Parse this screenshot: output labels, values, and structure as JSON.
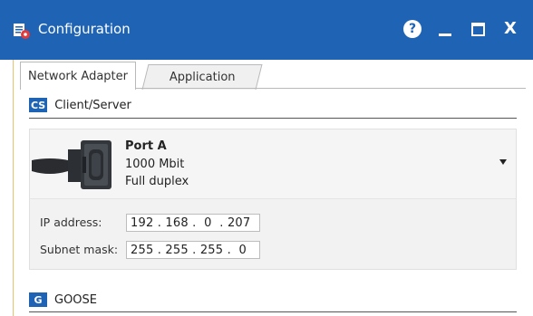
{
  "window": {
    "title": "Configuration",
    "controls": {
      "help": "?",
      "minimize": "_",
      "maximize": "□",
      "close": "X"
    }
  },
  "tabs": [
    {
      "label": "Network Adapter",
      "active": true
    },
    {
      "label": "Application",
      "active": false
    }
  ],
  "client_server": {
    "badge": "CS",
    "title": "Client/Server",
    "adapter": {
      "name": "Port A",
      "speed": "1000 Mbit",
      "duplex": "Full duplex"
    },
    "ip_address": {
      "label": "IP address:",
      "value": "192 . 168 .  0  . 207"
    },
    "subnet_mask": {
      "label": "Subnet mask:",
      "value": "255 . 255 . 255 .  0"
    }
  },
  "goose": {
    "badge": "G",
    "title": "GOOSE"
  },
  "colors": {
    "accent": "#1f64b4",
    "panel": "#f2f2f2"
  },
  "icons": [
    "app-config-icon",
    "help-icon",
    "minimize-icon",
    "maximize-icon",
    "close-icon",
    "ethernet-cable-icon",
    "dropdown-arrow-icon"
  ]
}
